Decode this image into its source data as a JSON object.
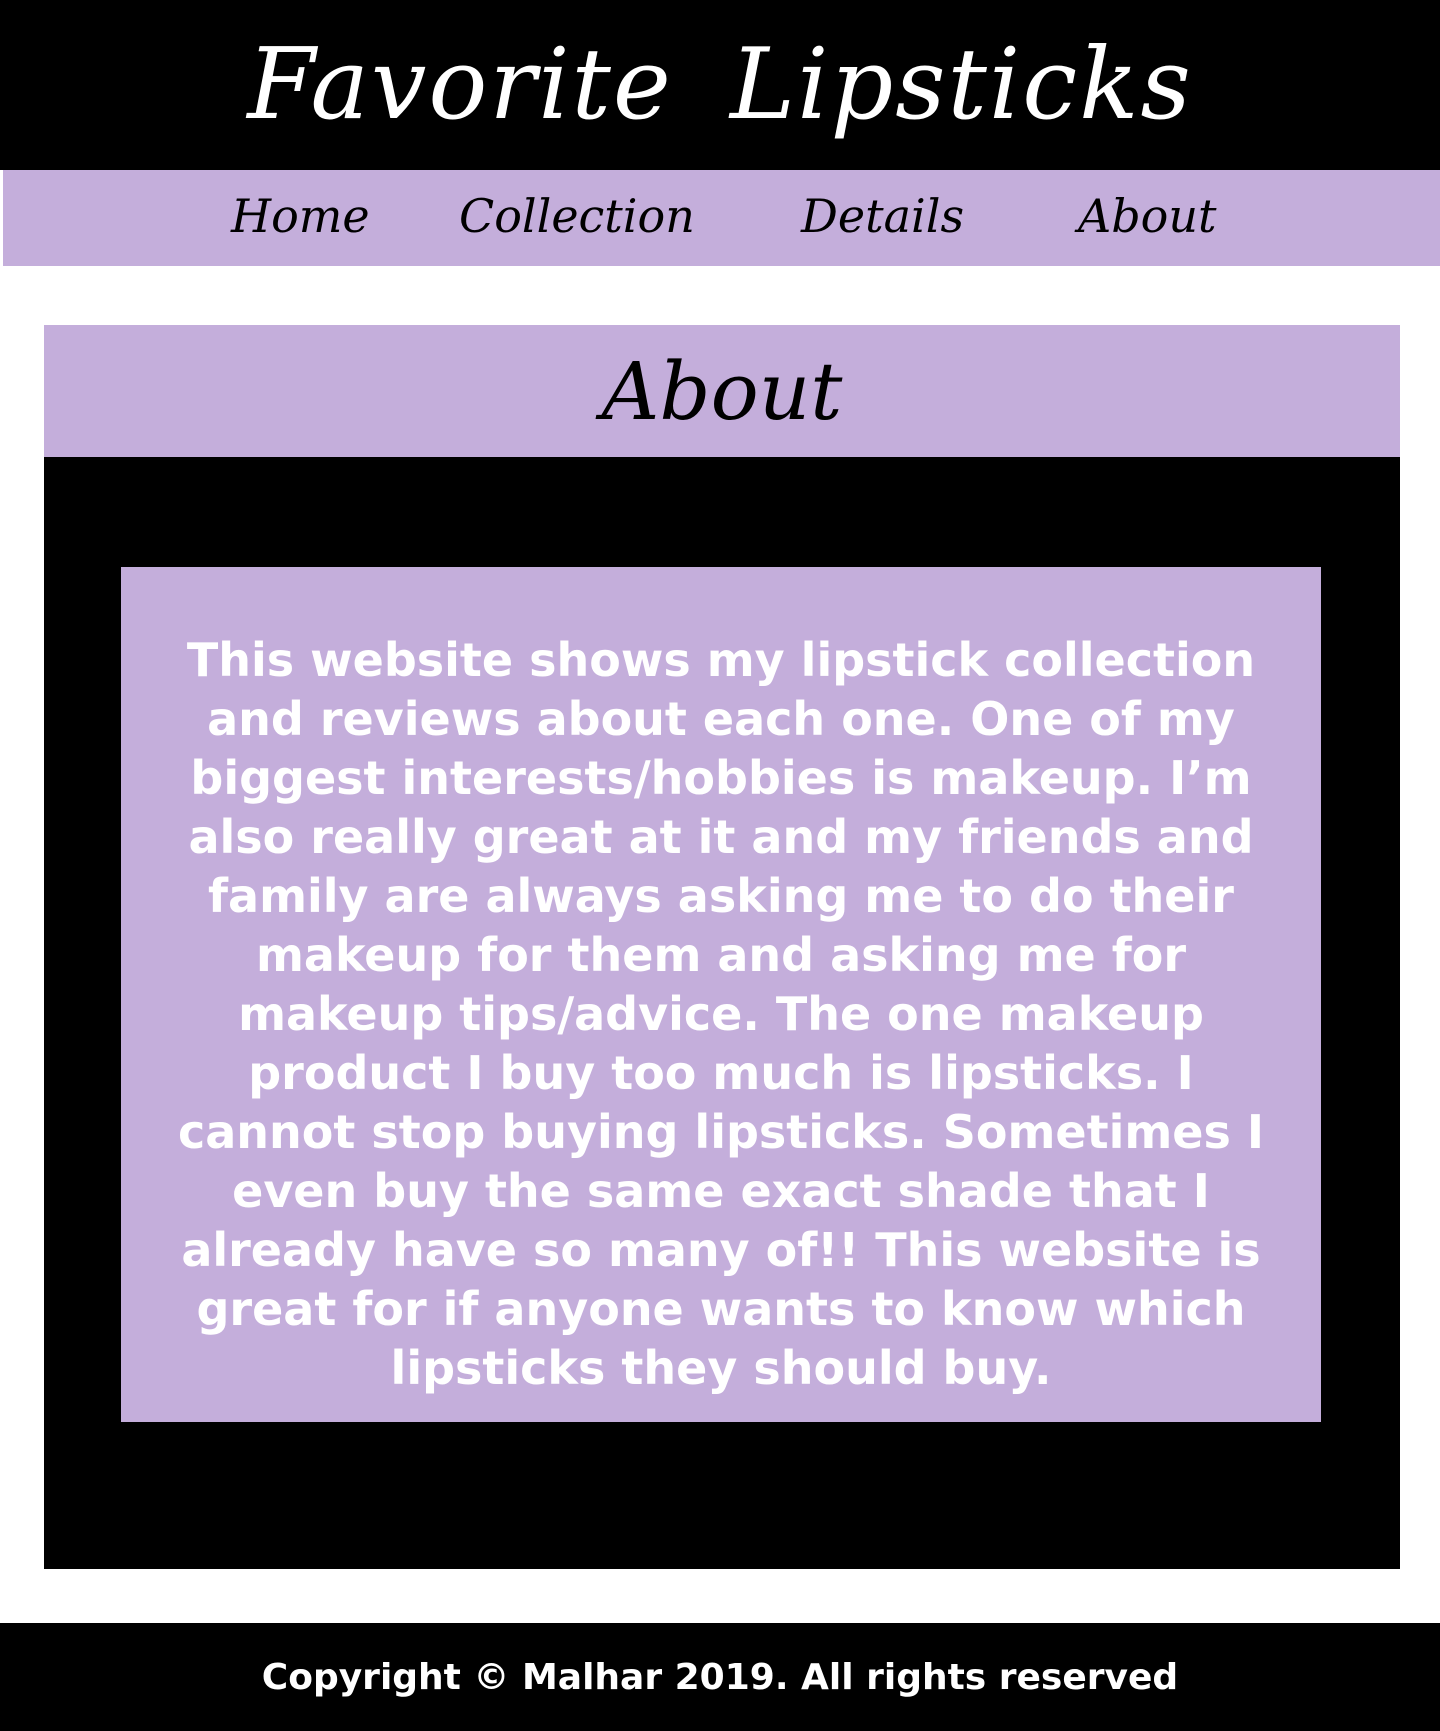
{
  "header": {
    "title": "Favorite Lipsticks"
  },
  "nav": {
    "items": [
      {
        "label": "Home"
      },
      {
        "label": "Collection"
      },
      {
        "label": "Details"
      },
      {
        "label": "About"
      }
    ]
  },
  "about": {
    "heading": "About",
    "body": "This website shows my lipstick collection and reviews about each one. One of my biggest interests/hobbies is makeup. I’m also really great at it and my friends and family are always asking me to do their makeup for them and asking me for makeup tips/advice. The one makeup product I buy too much is lipsticks. I cannot stop buying lipsticks. Sometimes I even buy the same exact shade that I already have so many of!! This website is great for if anyone wants to know which lipsticks they should buy."
  },
  "footer": {
    "text": "Copyright © Malhar 2019. All rights reserved"
  },
  "colors": {
    "accent": "#c4aedb",
    "dark": "#000000",
    "light": "#ffffff"
  }
}
